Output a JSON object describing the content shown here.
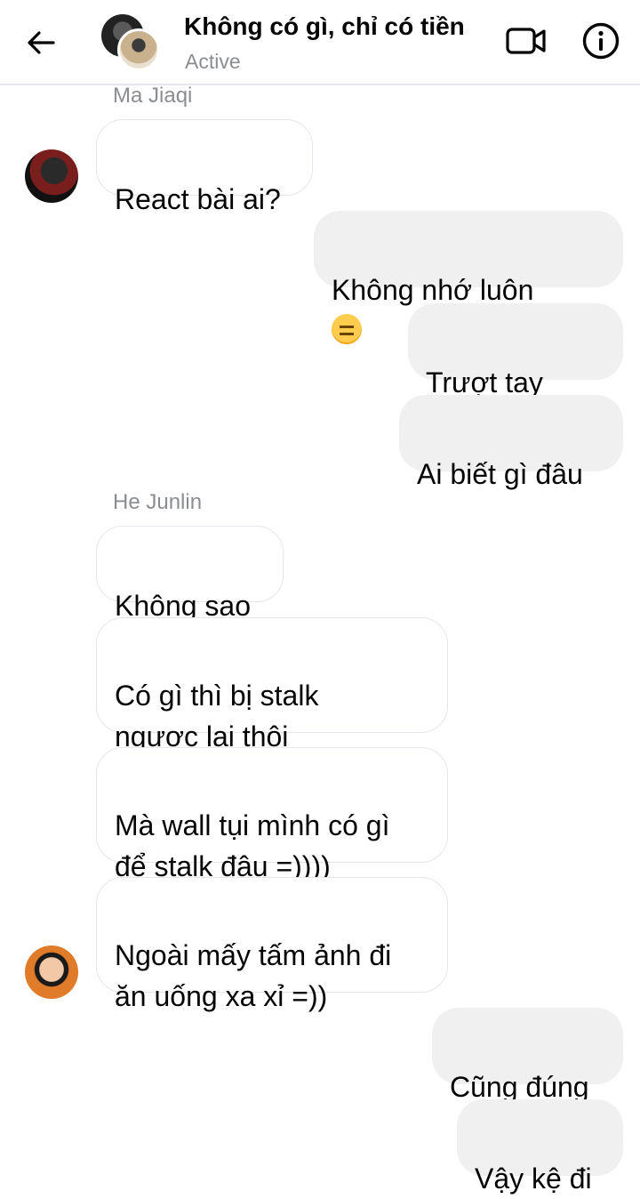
{
  "header": {
    "title": "Không có gì, chỉ có tiền",
    "status": "Active",
    "icons": [
      "back-arrow-icon",
      "video-call-icon",
      "info-icon"
    ]
  },
  "messages": {
    "sender1": "Ma Jiaqi",
    "m1": "React bài ai?",
    "m2": "Không nhớ luôn",
    "m3": "Trượt tay",
    "m4": "Ai biết gì đâu",
    "sender2": "He Junlin",
    "m5": "Không sao",
    "m6": "Có gì thì bị stalk\nngược lại thôi",
    "m7": "Mà wall tụi mình có gì\nđể stalk đâu =))))",
    "m8": "Ngoài mấy tấm ảnh đi\năn uống xa xỉ =))",
    "m9": "Cũng đúng",
    "m10": "Vậy kệ đi"
  },
  "colors": {
    "incoming_bubble_border": "#e4e6eb",
    "outgoing_bubble": "#f0f0f0",
    "muted_text": "#8a8d91"
  }
}
